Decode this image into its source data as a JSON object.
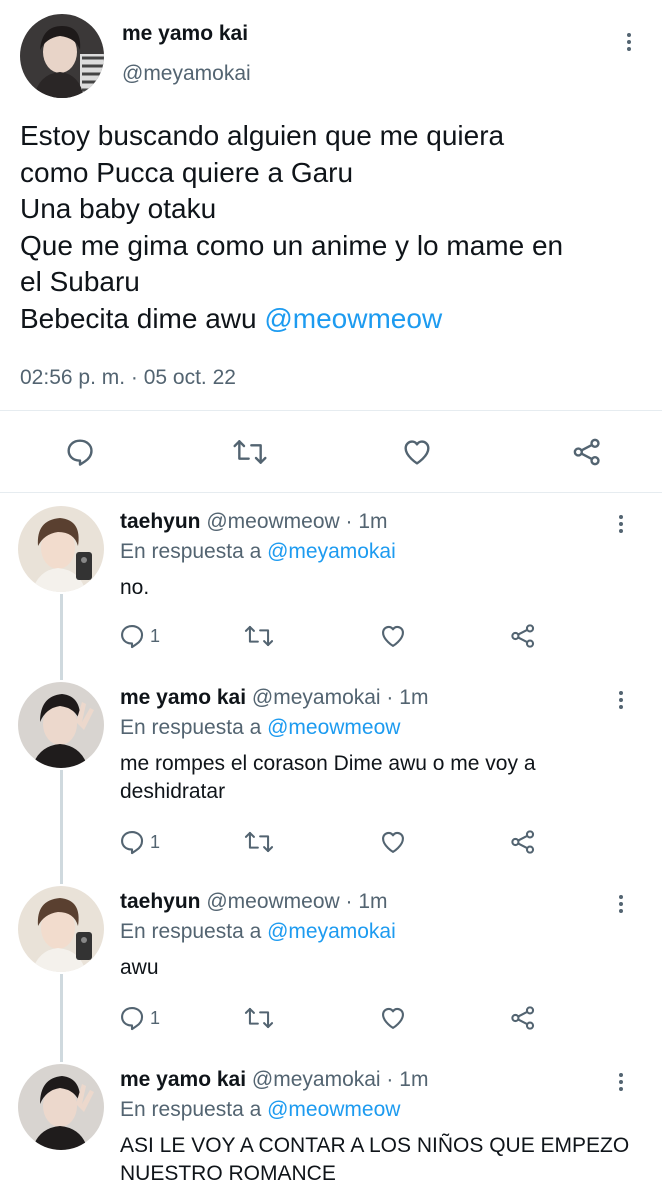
{
  "main_tweet": {
    "name": "me yamo kai",
    "handle": "@meyamokai",
    "lines": [
      "Estoy buscando alguien que me quiera",
      "como Pucca quiere a Garu",
      "Una baby otaku",
      "Que me gima como un anime y lo mame en",
      "el Subaru",
      "Bebecita dime awu "
    ],
    "mention": "@meowmeow",
    "timestamp": "02:56 p. m. · 05 oct. 22",
    "actions": [
      "reply-icon",
      "retweet-icon",
      "like-icon",
      "share-icon"
    ]
  },
  "replies": [
    {
      "name": "taehyun",
      "meta": " @meowmeow · 1m",
      "reply_prefix": "En respuesta a ",
      "reply_to": "@meyamokai",
      "text": "no.",
      "reply_count": "1"
    },
    {
      "name": "me yamo kai",
      "meta": " @meyamokai · 1m",
      "reply_prefix": "En respuesta a ",
      "reply_to": "@meowmeow",
      "text": "me rompes el corason Dime awu o me voy a deshidratar",
      "reply_count": "1"
    },
    {
      "name": "taehyun",
      "meta": " @meowmeow · 1m",
      "reply_prefix": "En respuesta a ",
      "reply_to": "@meyamokai",
      "text": "awu",
      "reply_count": "1"
    },
    {
      "name": "me yamo kai",
      "meta": " @meyamokai · 1m",
      "reply_prefix": "En respuesta a ",
      "reply_to": "@meowmeow",
      "text": "ASI LE VOY A CONTAR A LOS NIÑOS QUE EMPEZO NUESTRO ROMANCE",
      "reply_count": ""
    }
  ],
  "colors": {
    "accent": "#1d9bf0",
    "secondary_text": "#536471",
    "thread_line": "#cfd9de"
  }
}
